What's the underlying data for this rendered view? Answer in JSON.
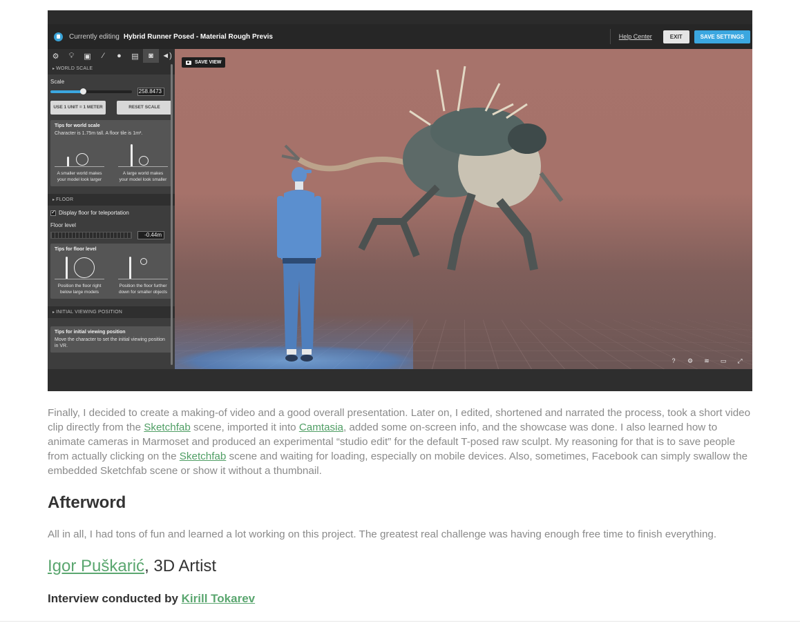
{
  "editor": {
    "currently_label": "Currently editing",
    "model_title": "Hybrid Runner Posed - Material Rough Previs",
    "help_center": "Help Center",
    "exit": "EXIT",
    "save_settings": "SAVE SETTINGS",
    "toolbar_icons": [
      "gear-icon",
      "lightbulb-icon",
      "image-icon",
      "magic-wand-icon",
      "pin-icon",
      "film-icon",
      "vr-headset-icon",
      "speaker-icon"
    ],
    "sections": {
      "world_scale": "WORLD SCALE",
      "floor": "FLOOR",
      "initial_viewing": "INITIAL VIEWING POSITION"
    },
    "scale": {
      "label": "Scale",
      "value": "258.8473",
      "slider_fraction": 0.4,
      "use_unit_button": "USE 1 UNIT = 1 METER",
      "reset_button": "RESET SCALE"
    },
    "tips_world": {
      "title": "Tips for world scale",
      "text": "Character is 1.75m tall. A floor tile is 1m².",
      "left_caption": "A smaller world makes your model look larger",
      "right_caption": "A large world makes your model look smaller"
    },
    "floor": {
      "checkbox_label": "Display floor for teleportation",
      "level_label": "Floor level",
      "level_value": "-0.44m"
    },
    "tips_floor": {
      "title": "Tips for floor level",
      "left_caption": "Position the floor right below large models",
      "right_caption": "Position the floor further down for smaller objects"
    },
    "tips_initial": {
      "title": "Tips for initial viewing position",
      "text": "Move the character to set the initial viewing position in VR."
    },
    "save_view": "SAVE VIEW",
    "viewer_icons": [
      "?",
      "⚙",
      "≋",
      "▭",
      "⤢"
    ]
  },
  "article": {
    "paragraph1": {
      "p1": "Finally, I decided to create a making-of video and a good overall presentation. Later on, I edited, shortened and narrated the process, took a short video clip directly from the ",
      "link1": "Sketchfab",
      "p2": " scene, imported it into ",
      "link2": "Camtasia",
      "p3": ", added some on-screen info, and the showcase was done. I also learned how to animate cameras in Marmoset and produced an experimental “studio edit” for the default T-posed raw sculpt. My reasoning for that is to save people from actually clicking on the ",
      "link3": "Sketchfab",
      "p4": " scene and waiting for loading, especially on mobile devices. Also, sometimes, Facebook can simply swallow the embedded Sketchfab scene or show it without a thumbnail."
    },
    "afterword_heading": "Afterword",
    "afterword_text": "All in all, I had tons of fun and learned a lot working on this project. The greatest real challenge was having enough free time to finish everything.",
    "author_name": "Igor Puškarić",
    "author_role": ", 3D Artist",
    "interview_prefix": "Interview conducted by ",
    "interviewer": "Kirill Tokarev"
  },
  "colors": {
    "link": "#4f9e64",
    "accent_blue": "#3ba7e0",
    "viewport_bg": "#a7736b"
  }
}
